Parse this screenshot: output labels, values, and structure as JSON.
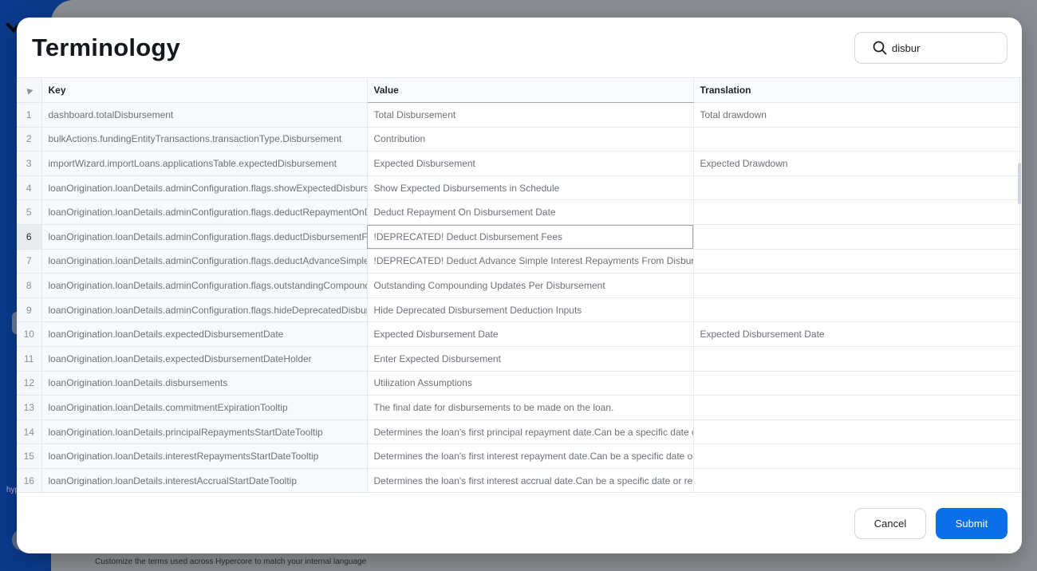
{
  "background": {
    "brand_text": "hyp",
    "footer_text": "Customize the terms used across Hypercore to match your internal language"
  },
  "modal": {
    "title": "Terminology",
    "search": {
      "value": "disbur",
      "icon": "search-icon"
    },
    "columns": {
      "key": "Key",
      "value": "Value",
      "translation": "Translation"
    },
    "rows": [
      {
        "n": "1",
        "key": "dashboard.totalDisbursement",
        "value": "Total Disbursement",
        "translation": "Total drawdown"
      },
      {
        "n": "2",
        "key": "bulkActions.fundingEntityTransactions.transactionType.Disbursement",
        "value": "Contribution",
        "translation": ""
      },
      {
        "n": "3",
        "key": "importWizard.importLoans.applicationsTable.expectedDisbursement",
        "value": "Expected Disbursement",
        "translation": "Expected Drawdown"
      },
      {
        "n": "4",
        "key": "loanOrigination.loanDetails.adminConfiguration.flags.showExpectedDisbursem",
        "value": "Show Expected Disbursements in Schedule",
        "translation": ""
      },
      {
        "n": "5",
        "key": "loanOrigination.loanDetails.adminConfiguration.flags.deductRepaymentOnDisb",
        "value": "Deduct Repayment On Disbursement Date",
        "translation": ""
      },
      {
        "n": "6",
        "key": "loanOrigination.loanDetails.adminConfiguration.flags.deductDisbursementFees",
        "value": "!DEPRECATED! Deduct Disbursement Fees",
        "translation": ""
      },
      {
        "n": "7",
        "key": "loanOrigination.loanDetails.adminConfiguration.flags.deductAdvanceSimpleInt",
        "value": "!DEPRECATED! Deduct Advance Simple Interest Repayments From Disbursemen",
        "translation": ""
      },
      {
        "n": "8",
        "key": "loanOrigination.loanDetails.adminConfiguration.flags.outstandingCompoundin",
        "value": "Outstanding Compounding Updates Per Disbursement",
        "translation": ""
      },
      {
        "n": "9",
        "key": "loanOrigination.loanDetails.adminConfiguration.flags.hideDeprecatedDisburse",
        "value": "Hide Deprecated Disbursement Deduction Inputs",
        "translation": ""
      },
      {
        "n": "10",
        "key": "loanOrigination.loanDetails.expectedDisbursementDate",
        "value": "Expected Disbursement Date",
        "translation": "Expected Disbursement Date"
      },
      {
        "n": "11",
        "key": "loanOrigination.loanDetails.expectedDisbursementDateHolder",
        "value": "Enter Expected Disbursement",
        "translation": ""
      },
      {
        "n": "12",
        "key": "loanOrigination.loanDetails.disbursements",
        "value": "Utilization Assumptions",
        "translation": ""
      },
      {
        "n": "13",
        "key": "loanOrigination.loanDetails.commitmentExpirationTooltip",
        "value": "The final date for disbursements to be made on the loan.",
        "translation": ""
      },
      {
        "n": "14",
        "key": "loanOrigination.loanDetails.principalRepaymentsStartDateTooltip",
        "value": "Determines the loan's first principal repayment date.Can be a specific date or re",
        "translation": ""
      },
      {
        "n": "15",
        "key": "loanOrigination.loanDetails.interestRepaymentsStartDateTooltip",
        "value": "Determines the loan's first interest repayment date.Can be a specific date or re",
        "translation": ""
      },
      {
        "n": "16",
        "key": "loanOrigination.loanDetails.interestAccrualStartDateTooltip",
        "value": "Determines the loan's first interest accrual date.Can be a specific date or relativ",
        "translation": ""
      }
    ],
    "active_row": "6",
    "buttons": {
      "cancel": "Cancel",
      "submit": "Submit"
    }
  },
  "colors": {
    "accent": "#0b6fe8",
    "title": "#15181c",
    "cell_text": "#6c7078"
  }
}
